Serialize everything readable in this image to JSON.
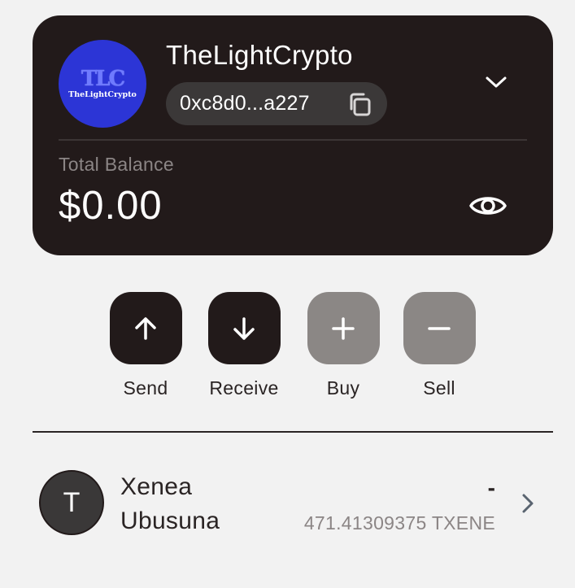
{
  "wallet": {
    "logo": {
      "monogram": "TLC",
      "text": "TheLightCrypto"
    },
    "account_name": "TheLightCrypto",
    "address": "0xc8d0...a227",
    "balance_label": "Total Balance",
    "balance_value": "$0.00",
    "icons": {
      "copy": "copy-icon",
      "dropdown": "chevron-down-icon",
      "visibility": "eye-icon"
    }
  },
  "actions": [
    {
      "label": "Send",
      "icon": "arrow-up-icon",
      "color": "#221a1a"
    },
    {
      "label": "Receive",
      "icon": "arrow-down-icon",
      "color": "#221a1a"
    },
    {
      "label": "Buy",
      "icon": "plus-icon",
      "color": "#8b8785"
    },
    {
      "label": "Sell",
      "icon": "minus-icon",
      "color": "#8b8785"
    }
  ],
  "tokens": [
    {
      "initial": "T",
      "name": "Xenea Ubusuna",
      "fiat_value": "-",
      "amount": "471.41309375 TXENE"
    }
  ],
  "colors": {
    "background": "#f2f2f2",
    "card": "#221a1a",
    "logo_bg": "#2c35d6",
    "muted_text": "#8b8585"
  }
}
